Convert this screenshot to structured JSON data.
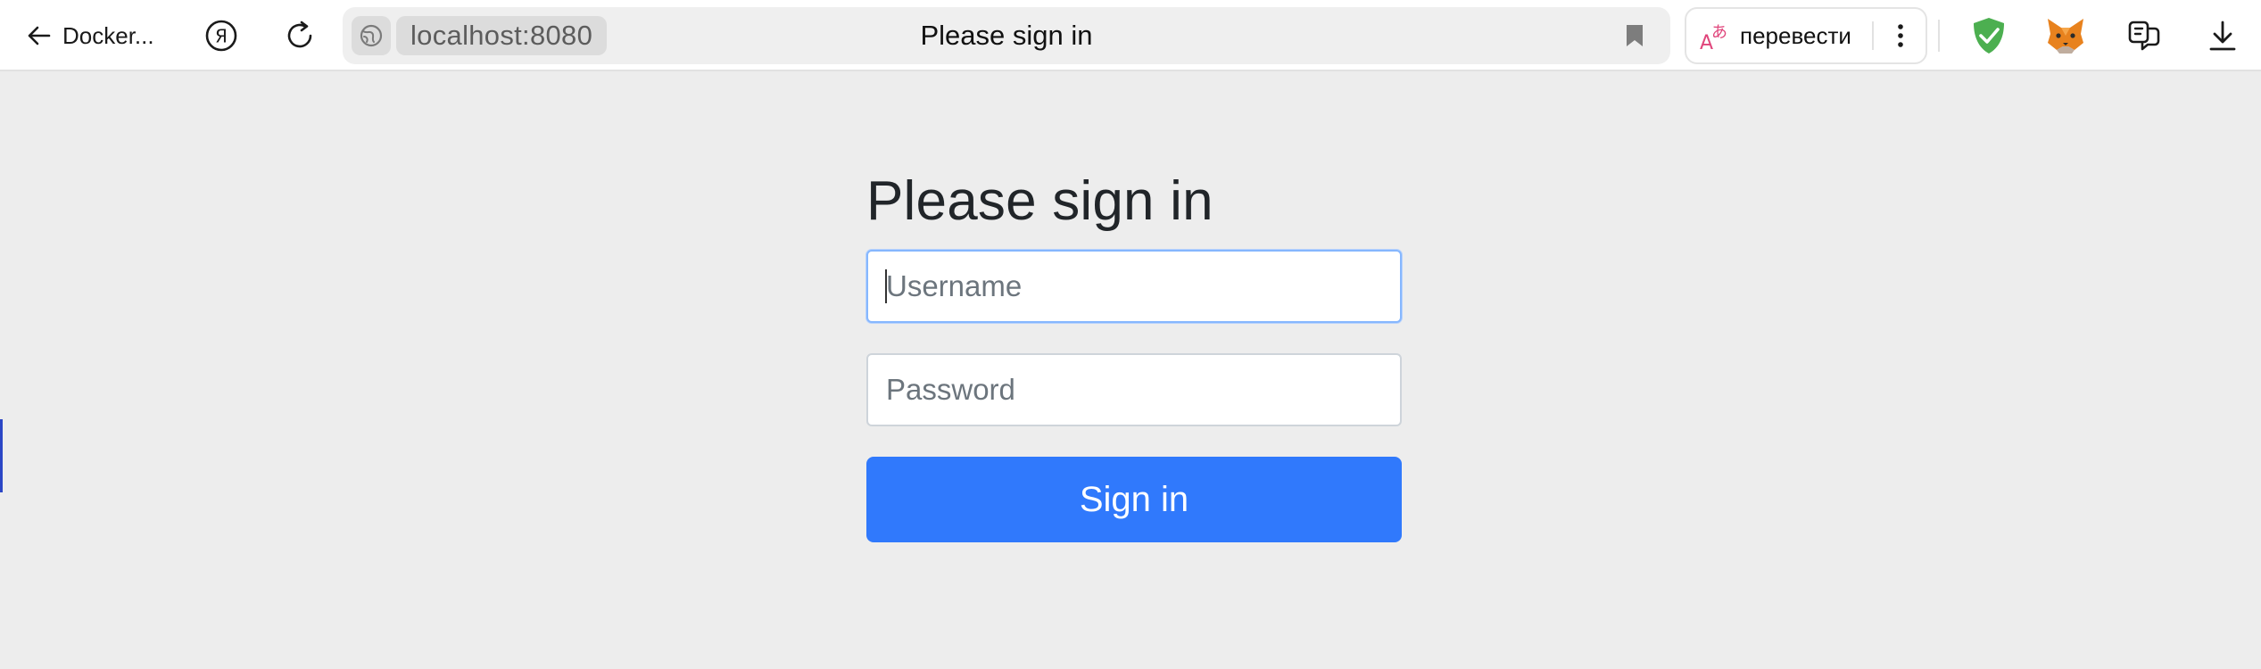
{
  "browser": {
    "back_label": "Docker...",
    "address": {
      "host": "localhost:8080",
      "tab_title": "Please sign in"
    },
    "translate_label": "перевести",
    "icons": {
      "back": "arrow-left-icon",
      "yandex": "yandex-icon",
      "reload": "reload-icon",
      "site_info": "globe-icon",
      "bookmark": "bookmark-icon",
      "translate": "translate-icon",
      "more": "more-vertical-icon",
      "extension_shield": "shield-check-icon",
      "extension_fox": "metamask-fox-icon",
      "extension_chat": "extension-chat-icon",
      "downloads": "download-icon"
    },
    "colors": {
      "shield": "#4caf50",
      "fox": "#e8821e",
      "translate_accent": "#e0457b"
    }
  },
  "login": {
    "heading": "Please sign in",
    "username_placeholder": "Username",
    "password_placeholder": "Password",
    "submit_label": "Sign in",
    "colors": {
      "button": "#3079fc",
      "focus_border": "#86b7fe"
    }
  }
}
